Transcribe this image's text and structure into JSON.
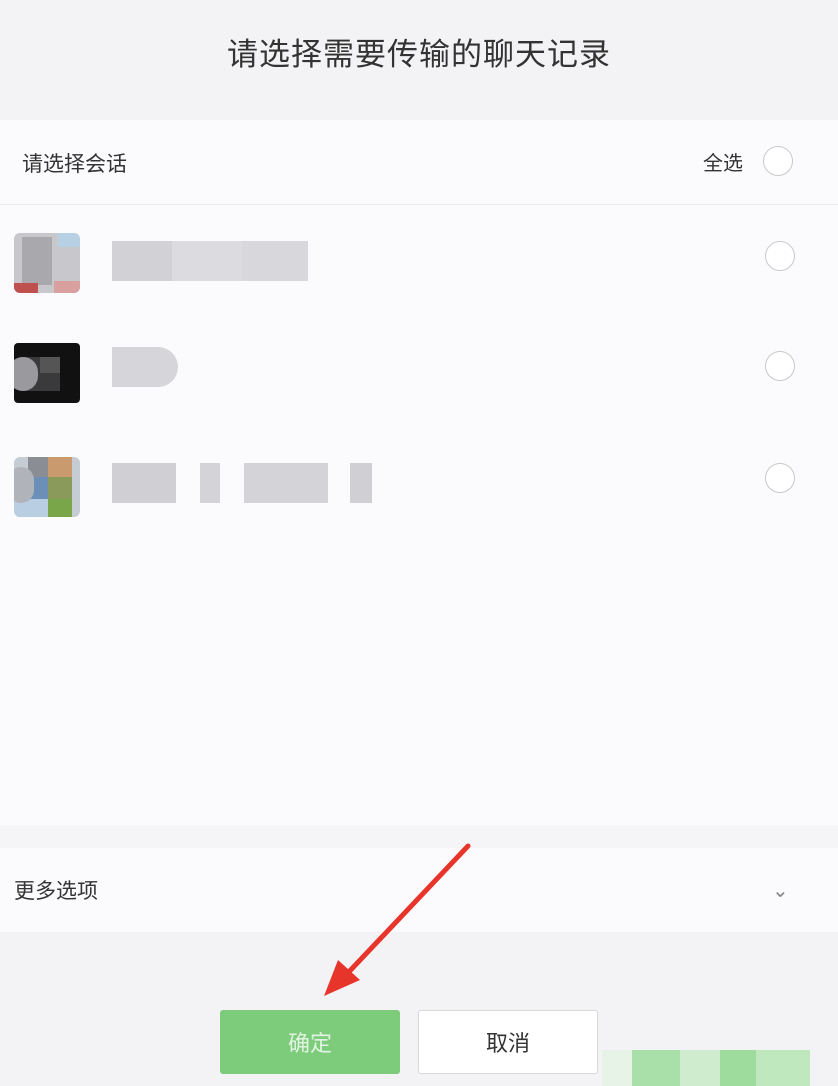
{
  "dialog": {
    "title": "请选择需要传输的聊天记录"
  },
  "conversations_header": {
    "label": "请选择会话",
    "select_all_label": "全选"
  },
  "conversations": [
    {
      "name": "",
      "selected": false
    },
    {
      "name": "",
      "selected": false
    },
    {
      "name": "",
      "selected": false
    }
  ],
  "more_options": {
    "label": "更多选项",
    "chevron_icon": "chevron-down-icon"
  },
  "actions": {
    "confirm_label": "确定",
    "cancel_label": "取消"
  },
  "colors": {
    "confirm_button": "#7ccc7c",
    "annotation_arrow": "#e8352b"
  }
}
